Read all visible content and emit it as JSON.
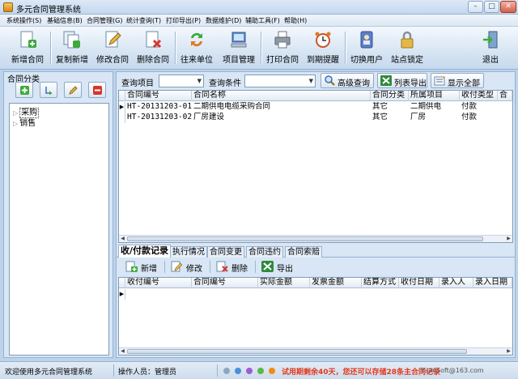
{
  "window": {
    "title": "多元合同管理系统",
    "minimize": "–",
    "maximize": "□",
    "close": "✕"
  },
  "menu": [
    "系统操作(S)",
    "基础信息(B)",
    "合同管理(G)",
    "统计查询(T)",
    "打印导出(P)",
    "数据维护(D)",
    "辅助工具(F)",
    "帮助(H)"
  ],
  "toolbar": {
    "new_contract": "新增合同",
    "copy_new": "复制新增",
    "edit_contract": "修改合同",
    "delete_contract": "删除合同",
    "partners": "往来单位",
    "projects": "项目管理",
    "print_contract": "打印合同",
    "due_reminder": "到期提醒",
    "switch_user": "切换用户",
    "lock_site": "站点锁定",
    "exit": "退出"
  },
  "left_panel": {
    "title": "合同分类",
    "tree": [
      {
        "label": "采购",
        "selected": true
      },
      {
        "label": "销售",
        "selected": false
      }
    ]
  },
  "query": {
    "item_label": "查询项目",
    "condition_label": "查询条件",
    "advanced": "高级查询",
    "export_list": "列表导出",
    "show_all": "显示全部"
  },
  "contracts": {
    "columns": [
      "合同编号",
      "合同名称",
      "合同分类",
      "所属项目",
      "收付类型",
      "合"
    ],
    "rows": [
      [
        "HT-20131203-01",
        "二期供电电缆采购合同",
        "其它",
        "二期供电",
        "付款"
      ],
      [
        "HT-20131203-02",
        "厂房建设",
        "其它",
        "厂房",
        "付款"
      ]
    ]
  },
  "tabs": [
    "收/付款记录",
    "执行情况",
    "合同变更",
    "合同违约",
    "合同索赔"
  ],
  "sub_toolbar": {
    "add": "新增",
    "edit": "修改",
    "delete": "删除",
    "export": "导出"
  },
  "payments": {
    "columns": [
      "收付编号",
      "合同编号",
      "实际金额",
      "发票金额",
      "结算方式",
      "收付日期",
      "录入人",
      "录入日期"
    ]
  },
  "status": {
    "welcome": "欢迎使用多元合同管理系统",
    "operator": "操作人员：管理员",
    "trial": "试用期剩余40天，您还可以存储28条主合同记录",
    "email": "YuanSoft@163.com",
    "dot_colors": [
      "#8fa6c2",
      "#4a8fd8",
      "#9b5fd0",
      "#58b84a",
      "#f08a18"
    ]
  },
  "colors": {
    "accent": "#c3d8ee",
    "trial_text": "#e23a1c"
  }
}
